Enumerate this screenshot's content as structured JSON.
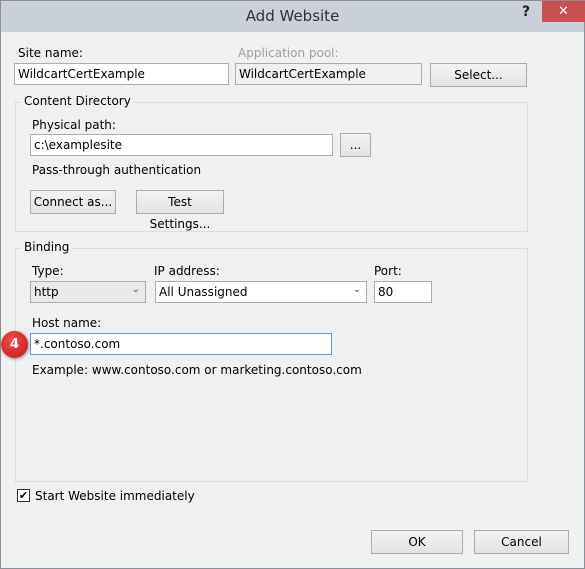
{
  "window": {
    "title": "Add Website",
    "help_label": "?",
    "close_label": "✕"
  },
  "site_name": {
    "label": "Site name:",
    "value": "WildcartCertExample"
  },
  "app_pool": {
    "label": "Application pool:",
    "value": "WildcartCertExample",
    "select_label": "Select..."
  },
  "content_directory": {
    "group_label": "Content Directory",
    "physical_path_label": "Physical path:",
    "physical_path_value": "c:\\examplesite",
    "browse_label": "...",
    "auth_text": "Pass-through authentication",
    "connect_as_label": "Connect as...",
    "test_settings_label": "Test Settings..."
  },
  "binding": {
    "group_label": "Binding",
    "type_label": "Type:",
    "type_value": "http",
    "ip_label": "IP address:",
    "ip_value": "All Unassigned",
    "port_label": "Port:",
    "port_value": "80",
    "host_label": "Host name:",
    "host_value": "*.contoso.com",
    "example_text": "Example: www.contoso.com or marketing.contoso.com",
    "step_badge": "4"
  },
  "start_website": {
    "label": "Start Website immediately",
    "checked": true
  },
  "footer": {
    "ok_label": "OK",
    "cancel_label": "Cancel"
  }
}
